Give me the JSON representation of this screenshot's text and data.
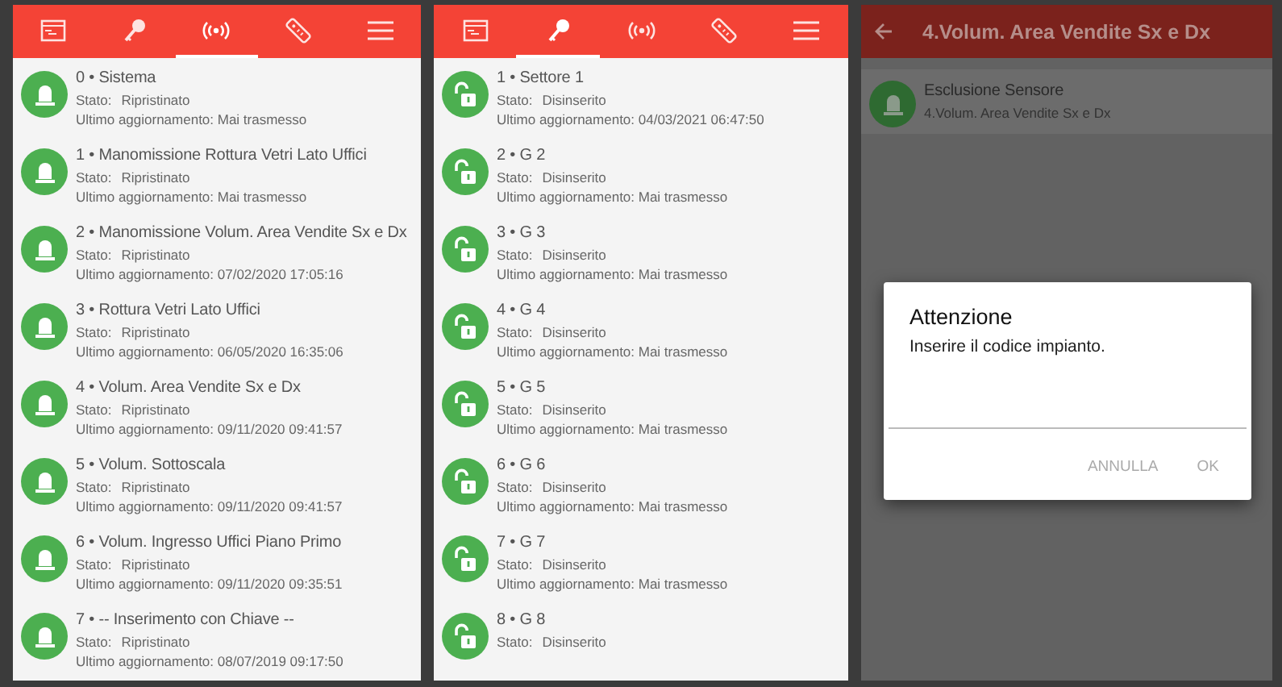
{
  "list_screens": [
    {
      "tabs": [
        {
          "selected": false
        },
        {
          "selected": false
        },
        {
          "selected": true
        },
        {
          "selected": false
        },
        {
          "selected": false
        }
      ],
      "items": [
        {
          "kind": "zone",
          "title": "0 • Sistema",
          "status_label": "Stato:",
          "status": "Ripristinato",
          "update": "Ultimo aggiornamento: Mai trasmesso"
        },
        {
          "kind": "zone",
          "title": "1 • Manomissione Rottura Vetri Lato Uffici",
          "status_label": "Stato:",
          "status": "Ripristinato",
          "update": "Ultimo aggiornamento: Mai trasmesso"
        },
        {
          "kind": "zone",
          "title": "2 • Manomissione Volum. Area Vendite Sx e Dx",
          "status_label": "Stato:",
          "status": "Ripristinato",
          "update": "Ultimo aggiornamento: 07/02/2020 17:05:16"
        },
        {
          "kind": "zone",
          "title": "3 • Rottura Vetri Lato Uffici",
          "status_label": "Stato:",
          "status": "Ripristinato",
          "update": "Ultimo aggiornamento: 06/05/2020 16:35:06"
        },
        {
          "kind": "zone",
          "title": "4 • Volum. Area Vendite Sx e Dx",
          "status_label": "Stato:",
          "status": "Ripristinato",
          "update": "Ultimo aggiornamento: 09/11/2020 09:41:57"
        },
        {
          "kind": "zone",
          "title": "5 • Volum. Sottoscala",
          "status_label": "Stato:",
          "status": "Ripristinato",
          "update": "Ultimo aggiornamento: 09/11/2020 09:41:57"
        },
        {
          "kind": "zone",
          "title": "6 • Volum. Ingresso Uffici Piano Primo",
          "status_label": "Stato:",
          "status": "Ripristinato",
          "update": "Ultimo aggiornamento: 09/11/2020 09:35:51"
        },
        {
          "kind": "zone",
          "title": "7 • -- Inserimento con Chiave --",
          "status_label": "Stato:",
          "status": "Ripristinato",
          "update": "Ultimo aggiornamento: 08/07/2019 09:17:50"
        }
      ]
    },
    {
      "tabs": [
        {
          "selected": false
        },
        {
          "selected": true
        },
        {
          "selected": false
        },
        {
          "selected": false
        },
        {
          "selected": false
        }
      ],
      "items": [
        {
          "kind": "sector",
          "title": "1 • Settore 1",
          "status_label": "Stato:",
          "status": "Disinserito",
          "update": "Ultimo aggiornamento: 04/03/2021 06:47:50"
        },
        {
          "kind": "sector",
          "title": "2 • G 2",
          "status_label": "Stato:",
          "status": "Disinserito",
          "update": "Ultimo aggiornamento: Mai trasmesso"
        },
        {
          "kind": "sector",
          "title": "3 • G 3",
          "status_label": "Stato:",
          "status": "Disinserito",
          "update": "Ultimo aggiornamento: Mai trasmesso"
        },
        {
          "kind": "sector",
          "title": "4 • G 4",
          "status_label": "Stato:",
          "status": "Disinserito",
          "update": "Ultimo aggiornamento: Mai trasmesso"
        },
        {
          "kind": "sector",
          "title": "5 • G 5",
          "status_label": "Stato:",
          "status": "Disinserito",
          "update": "Ultimo aggiornamento: Mai trasmesso"
        },
        {
          "kind": "sector",
          "title": "6 • G 6",
          "status_label": "Stato:",
          "status": "Disinserito",
          "update": "Ultimo aggiornamento: Mai trasmesso"
        },
        {
          "kind": "sector",
          "title": "7 • G 7",
          "status_label": "Stato:",
          "status": "Disinserito",
          "update": "Ultimo aggiornamento: Mai trasmesso"
        },
        {
          "kind": "sector",
          "title": "8 • G 8",
          "status_label": "Stato:",
          "status": "Disinserito"
        }
      ]
    }
  ],
  "detail_screen": {
    "title": "4.Volum. Area Vendite Sx e Dx",
    "items": [
      {
        "kind": "zone",
        "title": "Esclusione Sensore",
        "subtitle": "4.Volum. Area Vendite Sx e Dx"
      }
    ],
    "dialog": {
      "title": "Attenzione",
      "message": "Inserire il codice impianto.",
      "buttons": [
        "ANNULLA",
        "OK"
      ]
    }
  }
}
